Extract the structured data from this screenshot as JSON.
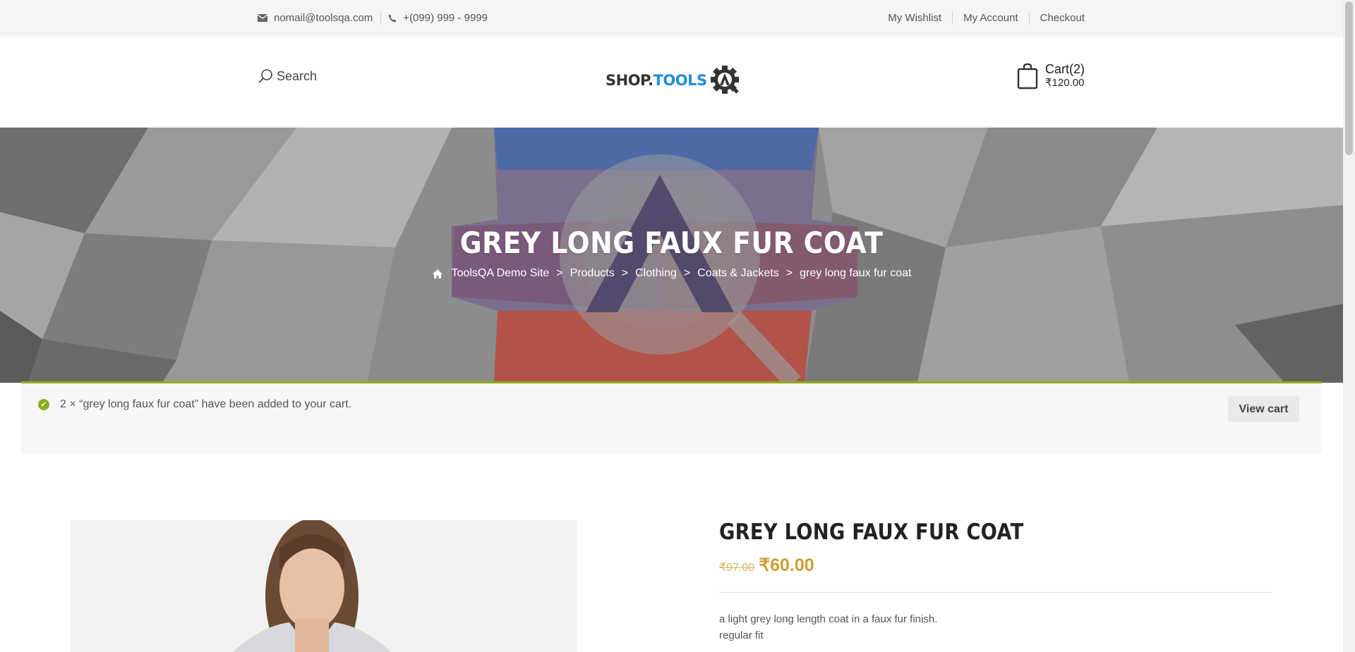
{
  "topbar": {
    "email": "nomail@toolsqa.com",
    "phone": "+(099) 999 - 9999",
    "links": [
      "My Wishlist",
      "My Account",
      "Checkout"
    ]
  },
  "header": {
    "search_label": "Search",
    "logo_part1": "SHOP.",
    "logo_part2": "TOOLS",
    "cart_label": "Cart(2)",
    "cart_total": "₹120.00"
  },
  "banner": {
    "title": "GREY LONG FAUX FUR COAT",
    "breadcrumbs": [
      "ToolsQA Demo Site",
      "Products",
      "Clothing",
      "Coats & Jackets",
      "grey long faux fur coat"
    ],
    "separator": ">"
  },
  "notice": {
    "message": "2 × “grey long faux fur coat” have been added to your cart.",
    "button": "View cart"
  },
  "product": {
    "title": "GREY LONG FAUX FUR COAT",
    "old_price": "₹97.00",
    "new_price": "₹60.00",
    "description": [
      "a light grey long length coat in a faux fur finish.",
      "regular fit"
    ]
  },
  "colors": {
    "accent_green": "#8fae1b",
    "price_gold": "#cf9d34",
    "logo_blue": "#1e8fd8"
  }
}
